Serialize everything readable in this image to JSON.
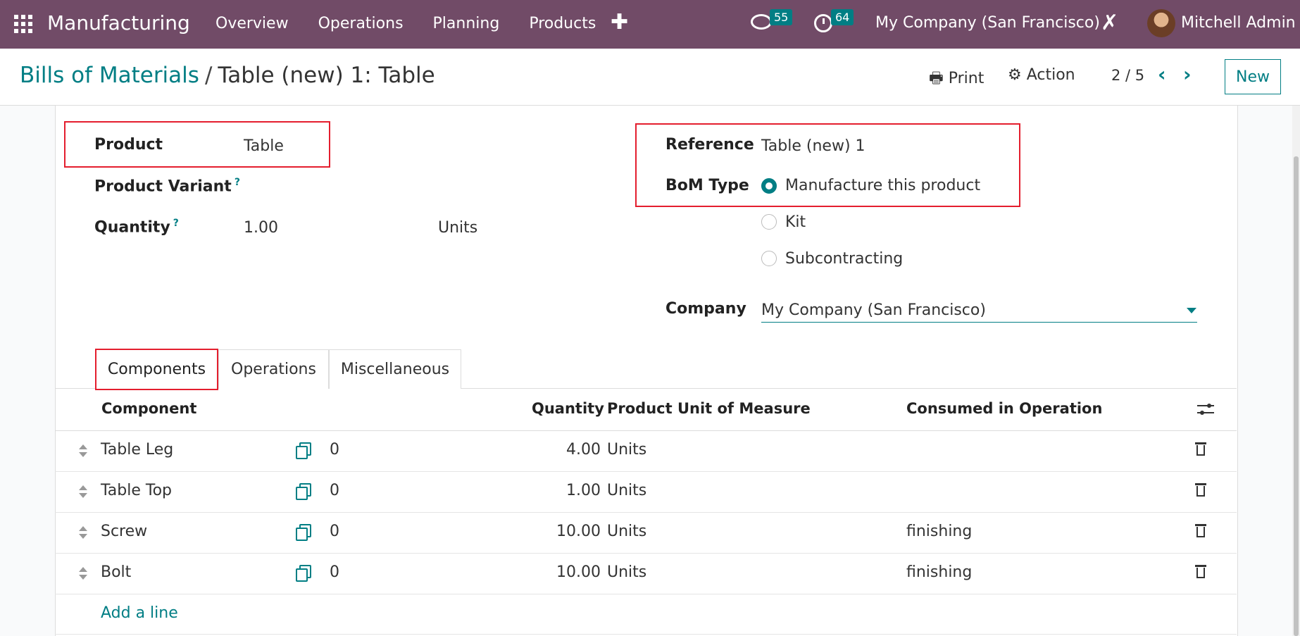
{
  "navbar": {
    "app_title": "Manufacturing",
    "menu": [
      "Overview",
      "Operations",
      "Planning",
      "Products"
    ],
    "plus": "✚",
    "messages_badge": "55",
    "activities_badge": "64",
    "company": "My Company (San Francisco)",
    "user": "Mitchell Admin"
  },
  "control": {
    "breadcrumb_parent": "Bills of Materials",
    "breadcrumb_sep": "/",
    "breadcrumb_current": "Table (new) 1: Table",
    "print_label": "🖶 Print",
    "action_label": "⚙ Action",
    "pager": "2 / 5",
    "prev": "‹",
    "next": "›",
    "new_label": "New"
  },
  "form": {
    "product_label": "Product",
    "product_value": "Table",
    "variant_label": "Product Variant",
    "help": "?",
    "quantity_label": "Quantity",
    "quantity_value": "1.00",
    "quantity_uom": "Units",
    "reference_label": "Reference",
    "reference_value": "Table (new) 1",
    "bom_type_label": "BoM Type",
    "bom_types": [
      "Manufacture this product",
      "Kit",
      "Subcontracting"
    ],
    "bom_type_selected": "Manufacture this product",
    "company_label": "Company",
    "company_value": "My Company (San Francisco)"
  },
  "tabs": [
    "Components",
    "Operations",
    "Miscellaneous"
  ],
  "active_tab": "Components",
  "table": {
    "headers": [
      "Component",
      "Quantity",
      "Product Unit of Measure",
      "Consumed in Operation"
    ],
    "rows": [
      {
        "component": "Table Leg",
        "forecast": "0",
        "quantity": "4.00",
        "uom": "Units",
        "operation": ""
      },
      {
        "component": "Table Top",
        "forecast": "0",
        "quantity": "1.00",
        "uom": "Units",
        "operation": ""
      },
      {
        "component": "Screw",
        "forecast": "0",
        "quantity": "10.00",
        "uom": "Units",
        "operation": "finishing"
      },
      {
        "component": "Bolt",
        "forecast": "0",
        "quantity": "10.00",
        "uom": "Units",
        "operation": "finishing"
      }
    ],
    "add_line": "Add a line"
  },
  "colors": {
    "navbar": "#714b67",
    "accent": "#017e84",
    "highlight": "#e41e2e"
  }
}
